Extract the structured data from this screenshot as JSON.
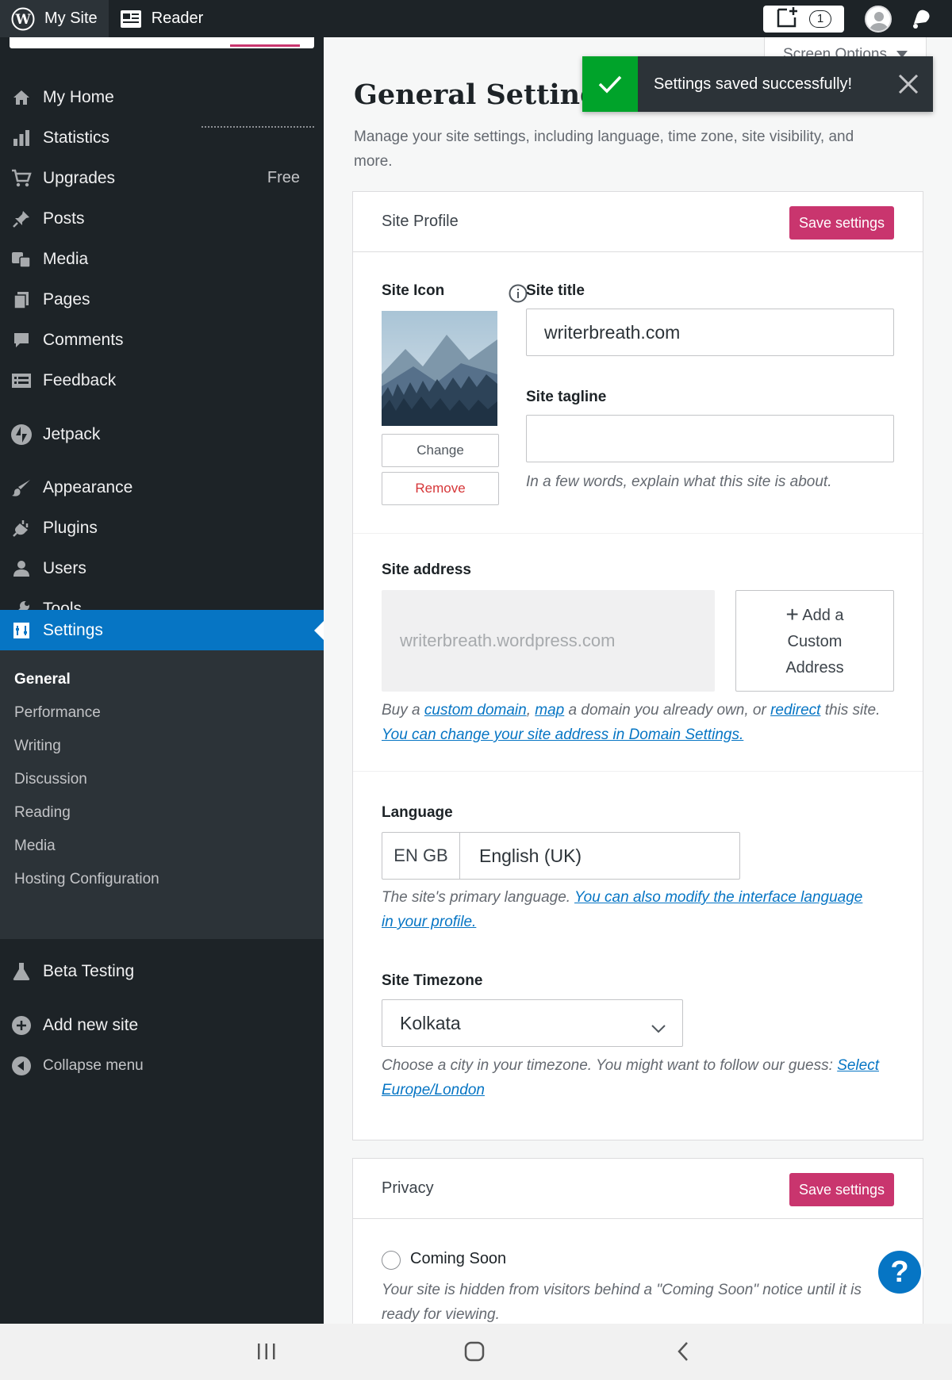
{
  "topbar": {
    "my_site_label": "My Site",
    "reader_label": "Reader",
    "notifications_count": "1"
  },
  "sidebar": {
    "items": [
      {
        "label": "My Home",
        "icon": "home-icon"
      },
      {
        "label": "Statistics",
        "icon": "bar-chart-icon"
      },
      {
        "label": "Upgrades",
        "icon": "cart-icon",
        "extra": "Free"
      },
      {
        "label": "Posts",
        "icon": "pin-icon"
      },
      {
        "label": "Media",
        "icon": "media-icon"
      },
      {
        "label": "Pages",
        "icon": "pages-icon"
      },
      {
        "label": "Comments",
        "icon": "comment-icon"
      },
      {
        "label": "Feedback",
        "icon": "feedback-icon"
      },
      {
        "label": "Jetpack",
        "icon": "jetpack-icon"
      },
      {
        "label": "Appearance",
        "icon": "brush-icon"
      },
      {
        "label": "Plugins",
        "icon": "plugin-icon"
      },
      {
        "label": "Users",
        "icon": "user-icon"
      },
      {
        "label": "Tools",
        "icon": "wrench-icon"
      },
      {
        "label": "Settings",
        "icon": "settings-icon"
      },
      {
        "label": "Beta Testing",
        "icon": "flask-icon"
      },
      {
        "label": "Add new site",
        "icon": "plus-circle-icon"
      },
      {
        "label": "Collapse menu",
        "icon": "collapse-icon"
      }
    ],
    "submenu": [
      "General",
      "Performance",
      "Writing",
      "Discussion",
      "Reading",
      "Media",
      "Hosting Configuration"
    ]
  },
  "screen_options": "Screen Options",
  "notice": "Settings saved successfully!",
  "page": {
    "title": "General Settings",
    "description": "Manage your site settings, including language, time zone, site visibility, and more."
  },
  "site_profile": {
    "header": "Site Profile",
    "save_label": "Save settings",
    "site_icon_label": "Site Icon",
    "change_label": "Change",
    "remove_label": "Remove",
    "site_title_label": "Site title",
    "site_title_value": "writerbreath.com",
    "tagline_label": "Site tagline",
    "tagline_value": "",
    "tagline_help": "In a few words, explain what this site is about.",
    "address_label": "Site address",
    "address_value": "writerbreath.wordpress.com",
    "custom_address_label": "Add a Custom Address",
    "address_help": {
      "t1": "Buy a ",
      "link1": "custom domain",
      "t2": ", ",
      "link2": "map",
      "t3": " a domain you already own, or ",
      "link3": "redirect",
      "t4": " this site. ",
      "link4": "You can change your site address in Domain Settings."
    },
    "language_label": "Language",
    "language_code": "EN GB",
    "language_value": "English (UK)",
    "language_help": "The site's primary language. ",
    "language_link": "You can also modify the interface language in your profile.",
    "timezone_label": "Site Timezone",
    "timezone_value": "Kolkata",
    "timezone_help": "Choose a city in your timezone. You might want to follow our guess: ",
    "timezone_link": "Select Europe/London"
  },
  "privacy": {
    "header": "Privacy",
    "save_label": "Save settings",
    "coming_soon_label": "Coming Soon",
    "coming_soon_help": "Your site is hidden from visitors behind a \"Coming Soon\" notice until it is ready for viewing."
  },
  "help_button": "?",
  "colors": {
    "accent": "#0675c4",
    "primary_button": "#c9356e",
    "success": "#00a32a",
    "sidebar_bg": "#1d2327"
  }
}
